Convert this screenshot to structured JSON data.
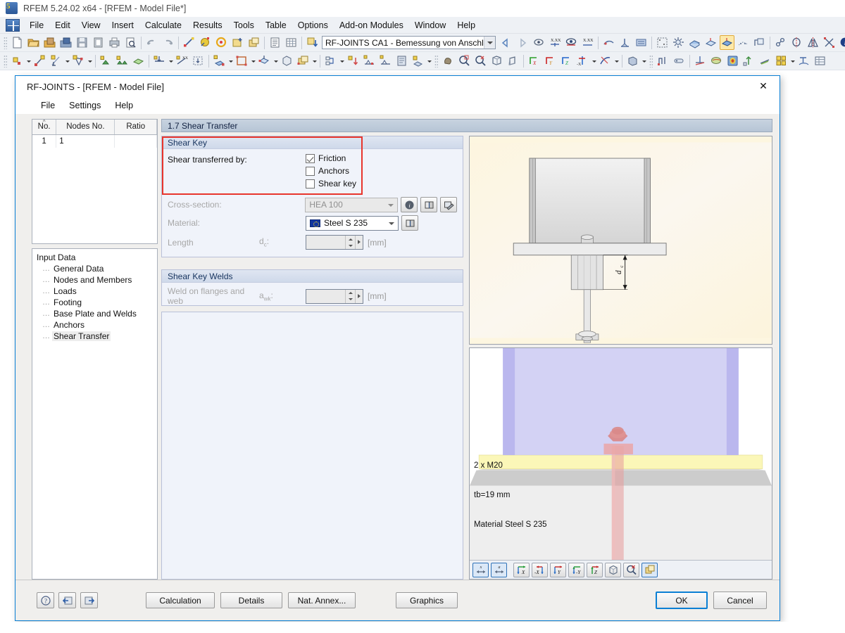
{
  "app": {
    "title": "RFEM 5.24.02 x64 - [RFEM - Model File*]",
    "icon": "rfem-logo-icon",
    "menu": [
      "File",
      "Edit",
      "View",
      "Insert",
      "Calculate",
      "Results",
      "Tools",
      "Table",
      "Options",
      "Add-on Modules",
      "Window",
      "Help"
    ],
    "toolbar_module_combo": "RF-JOINTS CA1 - Bemessung von Anschl"
  },
  "dialog": {
    "title": "RF-JOINTS - [RFEM - Model File]",
    "close_label": "✕",
    "menu": [
      "File",
      "Settings",
      "Help"
    ],
    "section_title": "1.7 Shear Transfer",
    "nodes_table": {
      "columns": [
        "No.",
        "Nodes No.",
        "Ratio"
      ],
      "rows": [
        {
          "no": "1",
          "nodes_no": "1",
          "ratio": ""
        }
      ]
    },
    "tree": {
      "root": "Input Data",
      "items": [
        {
          "label": "General Data",
          "selected": false
        },
        {
          "label": "Nodes and Members",
          "selected": false
        },
        {
          "label": "Loads",
          "selected": false
        },
        {
          "label": "Footing",
          "selected": false
        },
        {
          "label": "Base Plate and Welds",
          "selected": false
        },
        {
          "label": "Anchors",
          "selected": false
        },
        {
          "label": "Shear Transfer",
          "selected": true
        }
      ]
    },
    "shear_key_group": {
      "header": "Shear Key",
      "transferred_by_label": "Shear transferred by:",
      "options": [
        {
          "label": "Friction",
          "checked": true
        },
        {
          "label": "Anchors",
          "checked": false
        },
        {
          "label": "Shear key",
          "checked": false
        }
      ],
      "cross_section_label": "Cross-section:",
      "cross_section_value": "HEA 100",
      "material_label": "Material:",
      "material_value": "Steel S 235",
      "length_label": "Length",
      "length_symbol": "d",
      "length_subscript": "c",
      "length_colon": ":",
      "length_value": "",
      "length_unit": "[mm]",
      "info_button": "info-icon",
      "library_button": "library-icon",
      "edit_button": "edit-section-icon"
    },
    "shear_key_welds_group": {
      "header": "Shear Key Welds",
      "weld_label": "Weld on flanges and web",
      "weld_symbol": "a",
      "weld_subscript": "wk",
      "weld_colon": ":",
      "weld_value": "",
      "weld_unit": "[mm]"
    },
    "graphics": {
      "detail_drawing_dim_label": "d",
      "detail_drawing_dim_sub": "c",
      "annotations": [
        "2 x M20",
        "tb=19 mm",
        "Material Steel S 235"
      ],
      "toolbar_buttons": [
        {
          "name": "show-dimension-x-button",
          "label": "x",
          "active": true
        },
        {
          "name": "show-dimension-a-button",
          "label": "a",
          "active": true
        },
        {
          "name": "view-x-button",
          "label": "X",
          "active": false
        },
        {
          "name": "view-minus-x-button",
          "label": "-X",
          "active": false
        },
        {
          "name": "view-y-button",
          "label": "Y",
          "active": false
        },
        {
          "name": "view-minus-y-button",
          "label": "-Y",
          "active": false
        },
        {
          "name": "view-z-button",
          "label": "Z",
          "active": false
        },
        {
          "name": "isometric-view-button",
          "label": "",
          "active": false
        },
        {
          "name": "zoom-all-button",
          "label": "",
          "active": false
        },
        {
          "name": "render-mode-button",
          "label": "",
          "active": true
        }
      ]
    },
    "footer": {
      "help_button": "help-icon",
      "prev_button": "previous-page-icon",
      "next_button": "next-page-icon",
      "buttons": [
        "Calculation",
        "Details",
        "Nat. Annex...",
        "Graphics"
      ],
      "ok_label": "OK",
      "cancel_label": "Cancel"
    }
  },
  "colors": {
    "accent_blue": "#0a7fd4",
    "highlight_red": "#e8352c",
    "group_header": "#16335e",
    "section_title_bg": "#c0cddd",
    "toolbar_bg": "#eef1f5",
    "dialog_bg": "#f0efed",
    "group_bg": "#f0f3fa",
    "column_3d": "#c5c6f0",
    "baseplate_3d": "#fbf6bb",
    "anchor_3d": "#e09090",
    "grout_3d": "#c9c9c9"
  }
}
